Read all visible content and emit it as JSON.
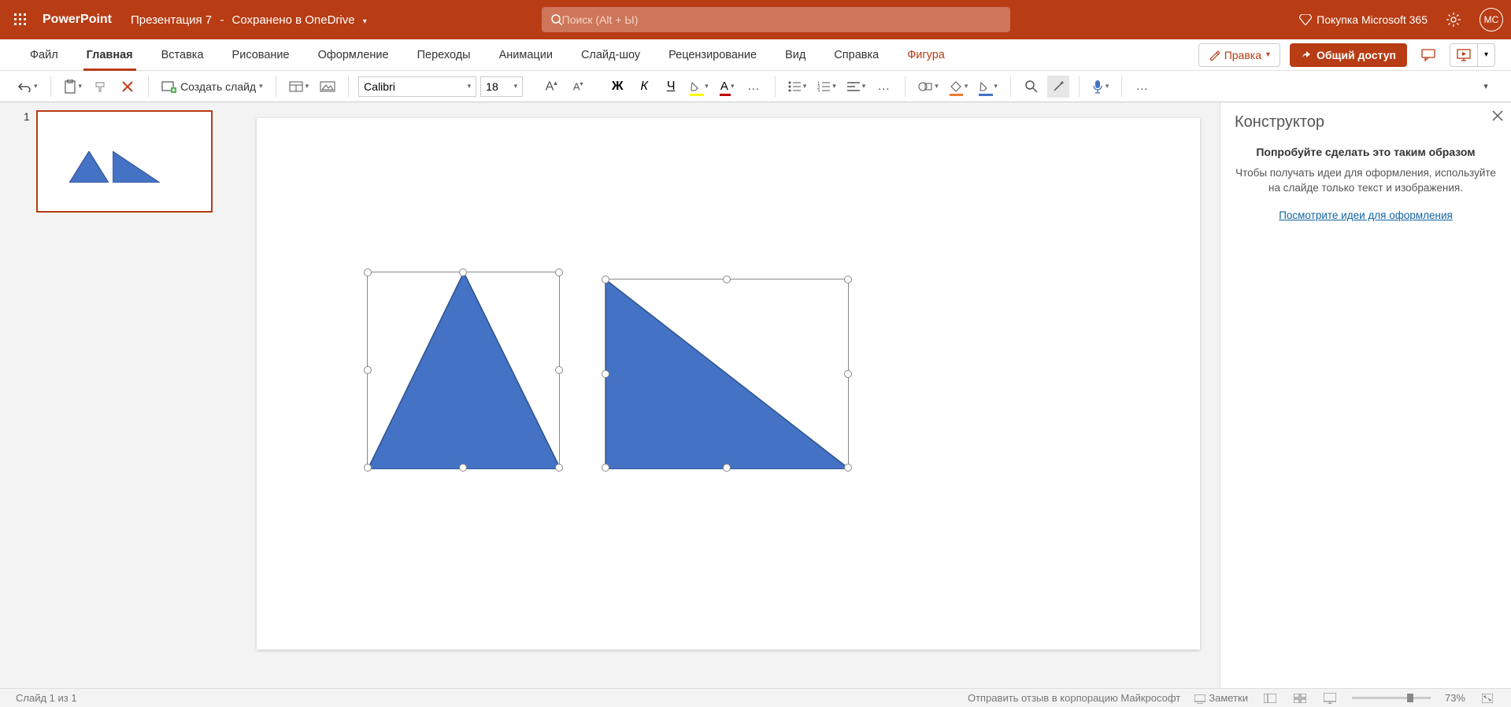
{
  "title_bar": {
    "app_name": "PowerPoint",
    "doc_name": "Презентация 7",
    "save_state": "Сохранено в OneDrive",
    "search_placeholder": "Поиск (Alt + Ы)",
    "premium_label": "Покупка Microsoft 365",
    "user_initials": "МС"
  },
  "tabs": {
    "file": "Файл",
    "home": "Главная",
    "insert": "Вставка",
    "draw": "Рисование",
    "design": "Оформление",
    "transitions": "Переходы",
    "animations": "Анимации",
    "slideshow": "Слайд-шоу",
    "review": "Рецензирование",
    "view": "Вид",
    "help": "Справка",
    "shape": "Фигура",
    "edit_btn": "Правка",
    "share_btn": "Общий доступ"
  },
  "toolbar": {
    "new_slide": "Создать слайд",
    "font_name": "Calibri",
    "font_size": "18",
    "bold": "Ж",
    "italic": "К",
    "underline": "Ч",
    "more": "…"
  },
  "thumbnails": {
    "slide1_num": "1"
  },
  "designer": {
    "title": "Конструктор",
    "subtitle": "Попробуйте сделать это таким образом",
    "body": "Чтобы получать идеи для оформления, используйте на слайде только текст и изображения.",
    "link": "Посмотрите идеи для оформления"
  },
  "status": {
    "slide_info": "Слайд 1 из 1",
    "feedback": "Отправить отзыв в корпорацию Майкрософт",
    "notes": "Заметки",
    "zoom": "73%"
  },
  "colors": {
    "brand": "#b83c14",
    "shape_fill": "#4472c4",
    "shape_stroke": "#2f528f"
  }
}
